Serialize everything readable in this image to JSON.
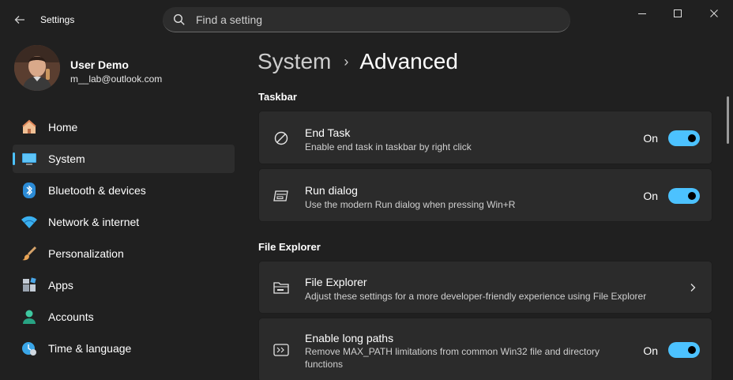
{
  "window": {
    "app_title": "Settings",
    "back_icon": "back-arrow-icon",
    "controls": [
      "minimize-icon",
      "maximize-icon",
      "close-icon"
    ]
  },
  "search": {
    "placeholder": "Find a setting",
    "icon": "search-icon"
  },
  "profile": {
    "name": "User Demo",
    "email": "m__lab@outlook.com"
  },
  "sidebar": {
    "items": [
      {
        "label": "Home",
        "icon": "home-icon"
      },
      {
        "label": "System",
        "icon": "system-display-icon",
        "selected": true
      },
      {
        "label": "Bluetooth & devices",
        "icon": "bluetooth-icon"
      },
      {
        "label": "Network & internet",
        "icon": "wifi-icon"
      },
      {
        "label": "Personalization",
        "icon": "paintbrush-icon"
      },
      {
        "label": "Apps",
        "icon": "apps-icon"
      },
      {
        "label": "Accounts",
        "icon": "accounts-icon"
      },
      {
        "label": "Time & language",
        "icon": "time-language-icon"
      }
    ]
  },
  "breadcrumb": {
    "parent": "System",
    "separator": "›",
    "current": "Advanced"
  },
  "sections": {
    "taskbar": {
      "title": "Taskbar",
      "items": [
        {
          "title": "End Task",
          "description": "Enable end task in taskbar by right click",
          "state_label": "On",
          "enabled": true,
          "icon": "end-task-icon"
        },
        {
          "title": "Run dialog",
          "description": "Use the modern Run dialog when pressing Win+R",
          "state_label": "On",
          "enabled": true,
          "icon": "run-dialog-icon"
        }
      ]
    },
    "file_explorer": {
      "title": "File Explorer",
      "items": [
        {
          "title": "File Explorer",
          "description": "Adjust these settings for a more developer-friendly experience using File Explorer",
          "icon": "file-explorer-icon",
          "chevron": "chevron-right-icon"
        },
        {
          "title": "Enable long paths",
          "description": "Remove MAX_PATH limitations from common Win32 file and directory functions",
          "state_label": "On",
          "enabled": true,
          "icon": "long-paths-icon"
        }
      ]
    }
  },
  "colors": {
    "accent": "#4cc2ff",
    "background": "#202020",
    "card": "#2b2b2b"
  }
}
